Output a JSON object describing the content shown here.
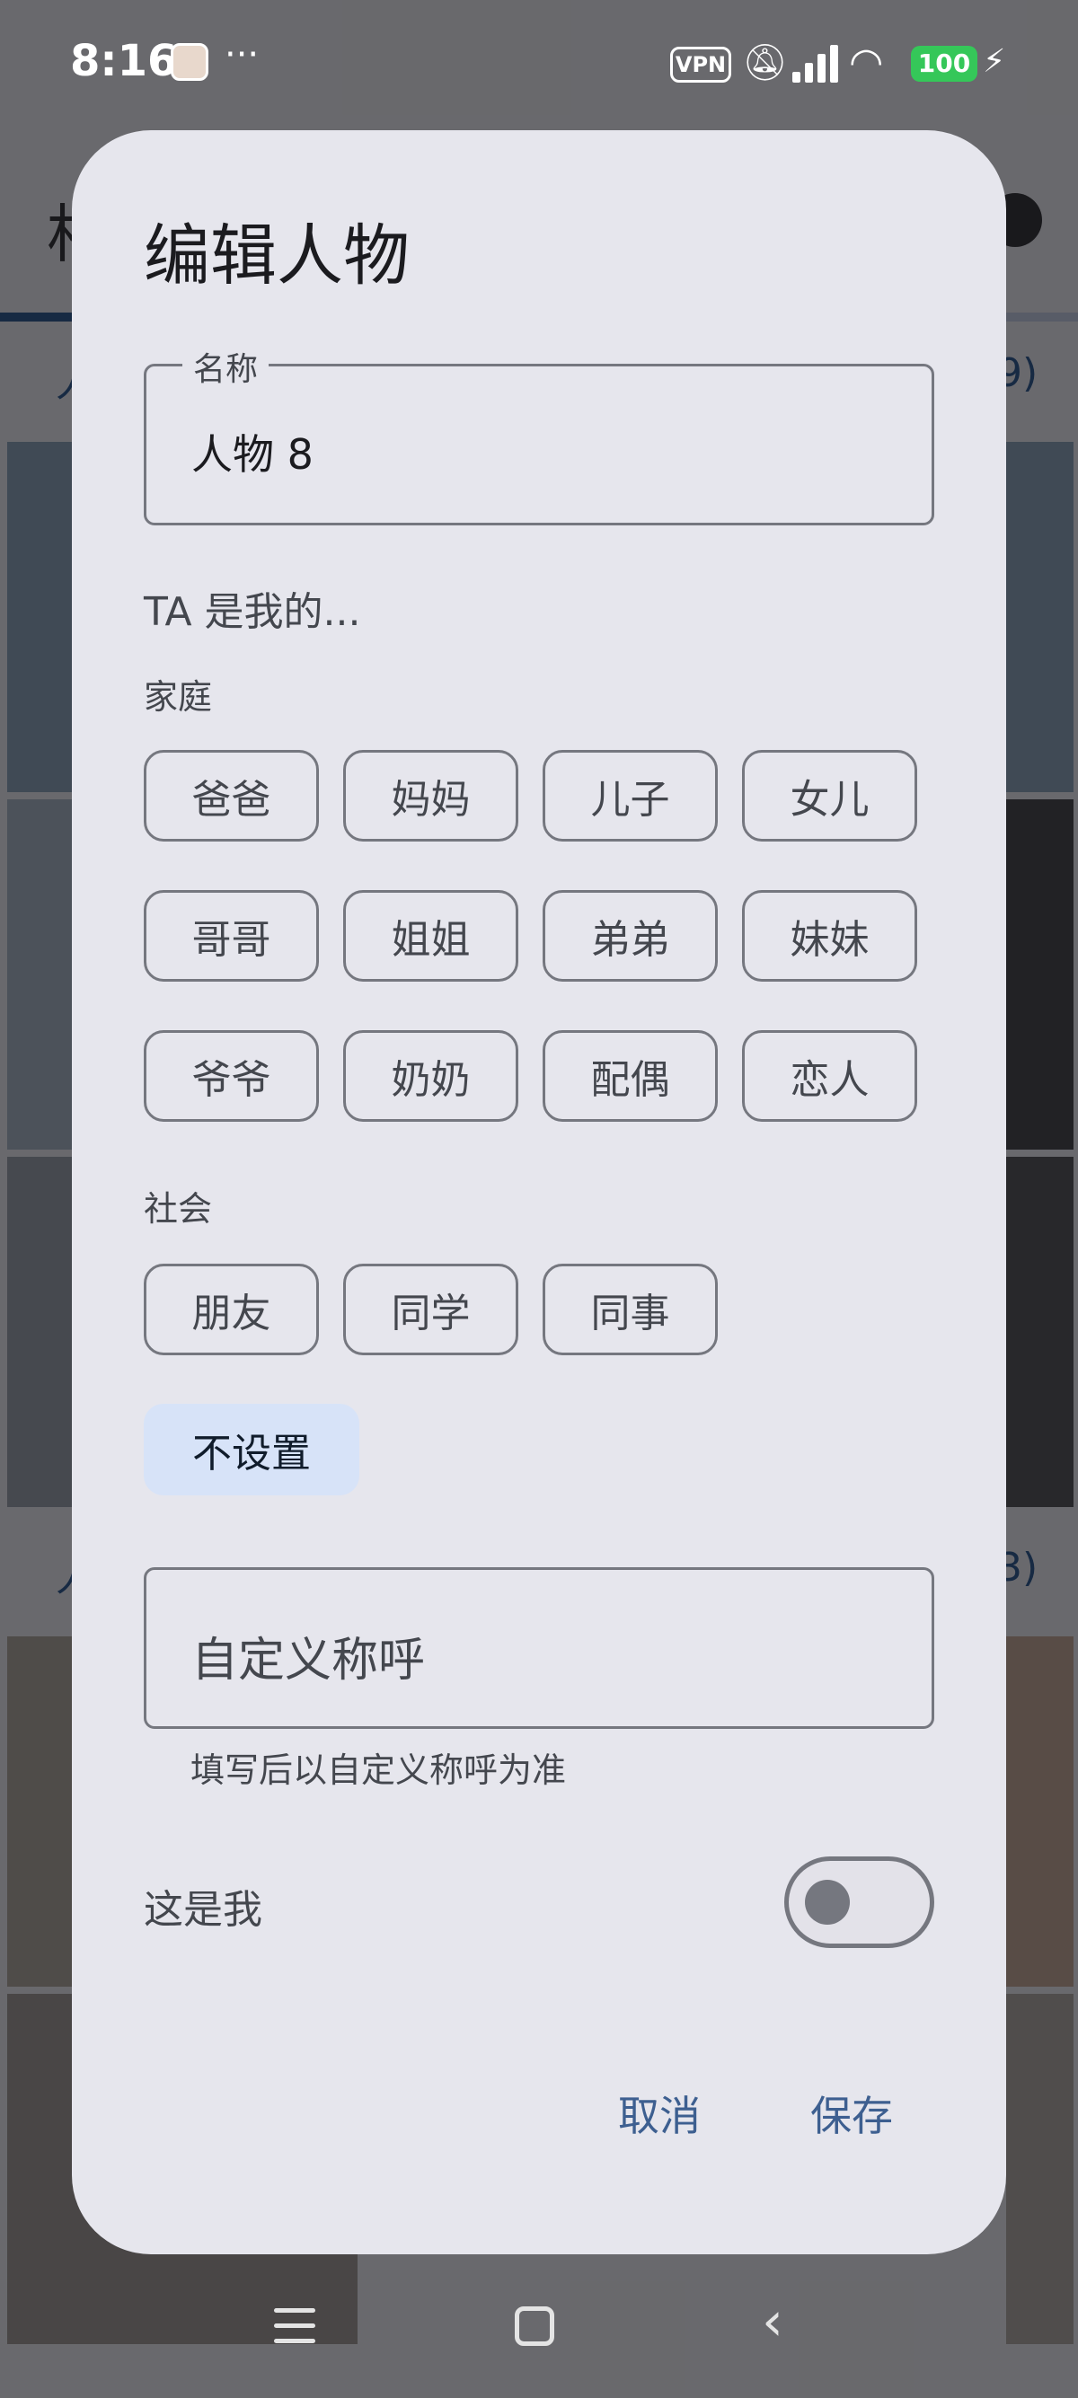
{
  "status_bar": {
    "time": "8:16",
    "more": "···",
    "vpn": "VPN",
    "battery": "100"
  },
  "background": {
    "title": "相",
    "row_labels": [
      "人",
      "9)",
      "人",
      "3)"
    ]
  },
  "dialog": {
    "title": "编辑人物",
    "name_field": {
      "label": "名称",
      "value": "人物 8"
    },
    "question": "TA 是我的...",
    "family": {
      "label": "家庭",
      "chips": [
        "爸爸",
        "妈妈",
        "儿子",
        "女儿",
        "哥哥",
        "姐姐",
        "弟弟",
        "妹妹",
        "爷爷",
        "奶奶",
        "配偶",
        "恋人"
      ]
    },
    "social": {
      "label": "社会",
      "chips": [
        "朋友",
        "同学",
        "同事"
      ]
    },
    "none_chip": "不设置",
    "custom_field": {
      "placeholder": "自定义称呼",
      "helper": "填写后以自定义称呼为准"
    },
    "is_me": {
      "label": "这是我",
      "checked": false
    },
    "buttons": {
      "cancel": "取消",
      "save": "保存"
    }
  },
  "colors": {
    "accent": "#3d5f90",
    "selected_chip_bg": "#d7e3f8",
    "dialog_bg": "#e6e6ed",
    "outline": "#75777f"
  }
}
